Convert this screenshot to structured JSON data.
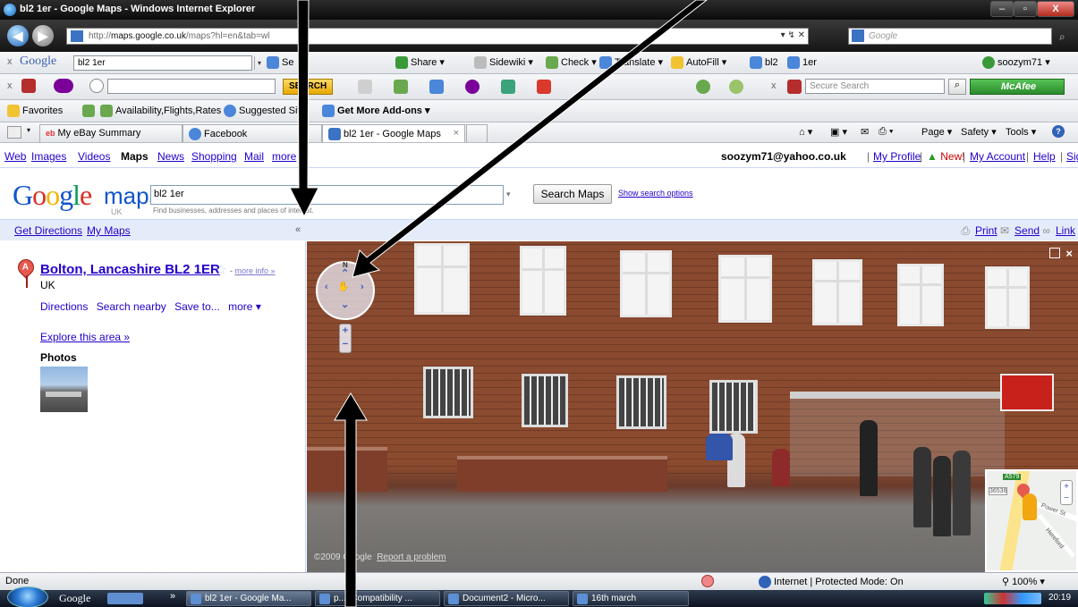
{
  "window": {
    "title": "bl2 1er - Google Maps - Windows Internet Explorer",
    "controls": {
      "minimize": "–",
      "maximize": "▫",
      "close": "X"
    }
  },
  "address_bar": {
    "url_prefix": "http://",
    "url_domain": "maps.google.co.uk",
    "url_rest": "/maps?hl=en&tab=wl",
    "controls": "▾ ↯ ✕",
    "search_placeholder": "Google"
  },
  "google_toolbar": {
    "brand": "Google",
    "query": "bl2 1er",
    "items": [
      "Se",
      "Share ▾",
      "Sidewiki ▾",
      "Check ▾",
      "Translate ▾",
      "AutoFill ▾",
      "bl2",
      "1er"
    ],
    "account": "soozym71 ▾"
  },
  "yahoo_toolbar": {
    "search_button": "SEARCH",
    "secure_search_placeholder": "Secure Search",
    "mcafee": "McAfee"
  },
  "favorites_bar": {
    "favorites": "Favorites",
    "items": [
      "Availability,Flights,Rates",
      "Suggested Sit",
      "Get More Add-ons ▾"
    ]
  },
  "tabs_bar": {
    "tabs": [
      "My eBay Summary",
      "Facebook",
      "bl2 1er - Google Maps"
    ],
    "close": "×",
    "right_tools": [
      "Page ▾",
      "Safety ▾",
      "Tools ▾"
    ]
  },
  "gbar": {
    "links": [
      "Web",
      "Images",
      "Videos",
      "Maps",
      "News",
      "Shopping",
      "Mail",
      "more"
    ],
    "current": "Maps",
    "email": "soozym71@yahoo.co.uk",
    "right_links": [
      "My Profile",
      "New!",
      "My Account",
      "Help",
      "Sign out"
    ],
    "separator": "|"
  },
  "search": {
    "logo_google": "Google",
    "logo_maps": "maps",
    "logo_uk": "UK",
    "query": "bl2 1er",
    "hint": "Find businesses, addresses and places of interest.",
    "button": "Search Maps",
    "options_link": "Show search options"
  },
  "strip": {
    "get_directions": "Get Directions",
    "my_maps": "My Maps",
    "collapse": "«",
    "print": "Print",
    "send": "Send",
    "link": "Link"
  },
  "result": {
    "marker": "A",
    "title": "Bolton, Lancashire BL2 1ER",
    "more_info_prefix": "- ",
    "more_info": "more info »",
    "country": "UK",
    "actions": [
      "Directions",
      "Search nearby",
      "Save to...",
      "more ▾"
    ],
    "explore": "Explore this area »",
    "photos_heading": "Photos"
  },
  "street_view": {
    "copyright": "©2009 Google",
    "report": "Report a problem",
    "north": "N",
    "minimap_road_label": "A579",
    "minimap_number": "36536",
    "minimap_street": "Power St",
    "minimap_street2": "Hereford"
  },
  "status_bar": {
    "left": "Done",
    "zone": "Internet | Protected Mode: On",
    "zoom": "100%"
  },
  "taskbar": {
    "google": "Google",
    "tasks": [
      "bl2 1er - Google Ma...",
      "p... [Compatibility ...",
      "Document2 - Micro...",
      "16th march"
    ],
    "clock": "20:19"
  }
}
